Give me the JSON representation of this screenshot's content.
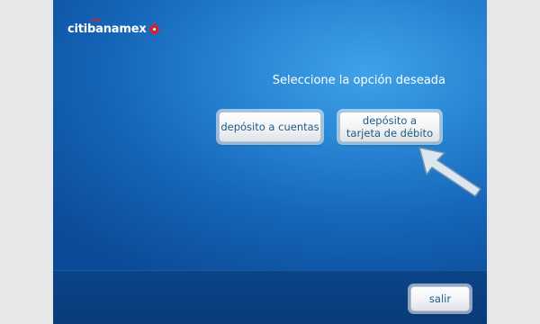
{
  "brand": {
    "logo_text": "citibanamex"
  },
  "main": {
    "prompt": "Seleccione la opción deseada"
  },
  "options": [
    {
      "label": "depósito a cuentas"
    },
    {
      "label": "depósito a\ntarjeta de débito"
    }
  ],
  "footer": {
    "exit_label": "salir"
  },
  "colors": {
    "screen_blue": "#1565b8",
    "footer_blue": "#0b4488",
    "button_text": "#1f5b86",
    "logo_red": "#d4232b",
    "arrow_fill": "#dbe6ee"
  },
  "icons": {
    "pointer": "pointing-arrow-icon",
    "logo_mark": "banamex-flower-icon"
  }
}
